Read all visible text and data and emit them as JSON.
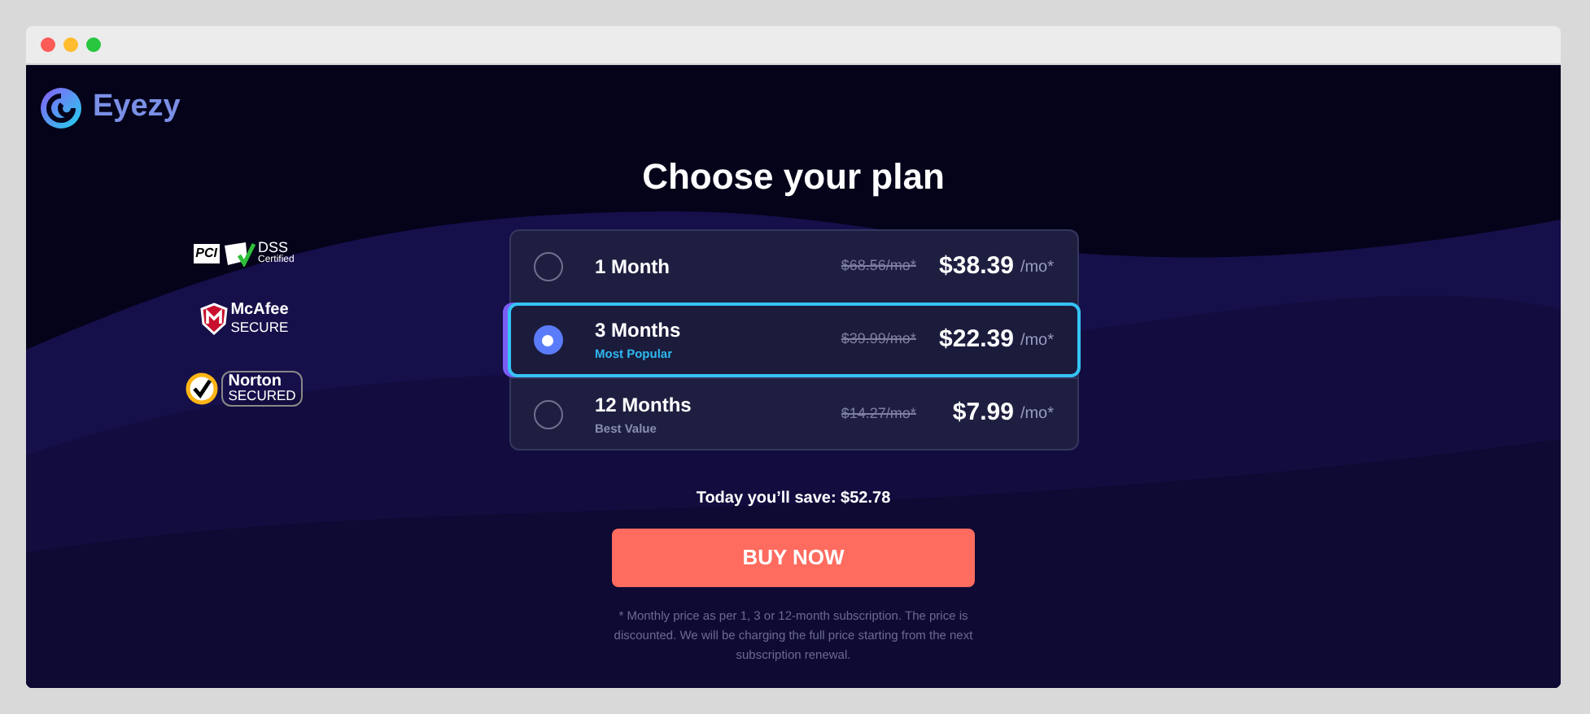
{
  "brand": {
    "name": "Eyezy"
  },
  "heading": "Choose your plan",
  "badges": [
    {
      "kind": "pci",
      "lines": [
        "PCI",
        "DSS",
        "Certified"
      ]
    },
    {
      "kind": "mcafee",
      "lines": [
        "McAfee",
        "SECURE"
      ]
    },
    {
      "kind": "norton",
      "lines": [
        "Norton",
        "SECURED"
      ]
    }
  ],
  "plans": [
    {
      "name": "1 Month",
      "old_price": "$68.56/mo*",
      "price": "$38.39",
      "unit": "/mo*",
      "selected": false
    },
    {
      "name": "3 Months",
      "tag": "Most Popular",
      "old_price": "$39.99/mo*",
      "price": "$22.39",
      "unit": "/mo*",
      "selected": true
    },
    {
      "name": "12 Months",
      "tag": "Best Value",
      "old_price": "$14.27/mo*",
      "price": "$7.99",
      "unit": "/mo*",
      "selected": false
    }
  ],
  "savings": "Today you’ll save: $52.78",
  "buy_button": "BUY NOW",
  "footnote": "* Monthly price as per 1, 3 or 12-month subscription. The price is discounted. We will be charging the full price starting from the next subscription renewal."
}
